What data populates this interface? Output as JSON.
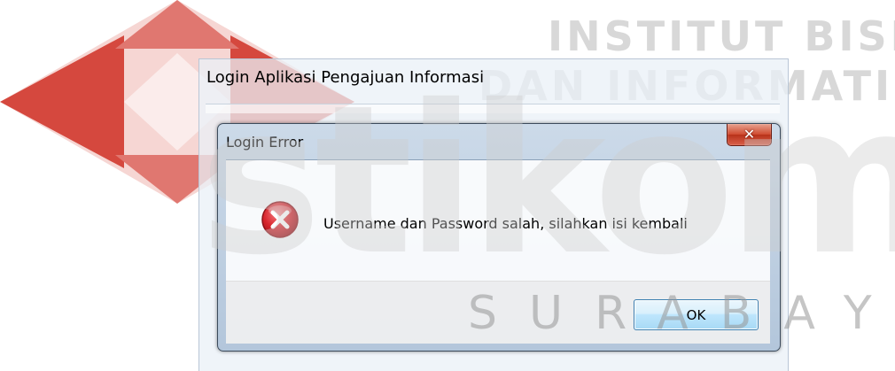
{
  "watermark": {
    "line1": "INSTITUT BISNIS",
    "line2": "DAN INFORMATIKA",
    "big_text": "stikom",
    "city": "SURABAYA",
    "logo_colors": [
      "#d33a2f",
      "#f3c3bf"
    ]
  },
  "background_window": {
    "title": "Login Aplikasi Pengajuan Informasi"
  },
  "dialog": {
    "title": "Login Error",
    "close_icon": "close-icon",
    "error_icon": "error-icon",
    "message": "Username dan Password salah, silahkan isi kembali",
    "ok_label": "OK",
    "colors": {
      "error_red": "#d8262d",
      "close_red": "#cf4a2f",
      "ok_border": "#3c7fb1"
    }
  }
}
